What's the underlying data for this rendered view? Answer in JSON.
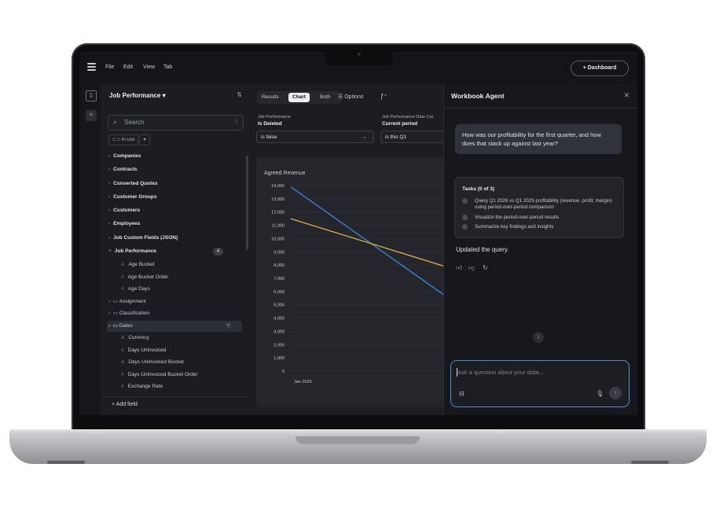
{
  "menu": {
    "file": "File",
    "edit": "Edit",
    "view": "View",
    "tab": "Tab",
    "dashboard_button": "+ Dashboard"
  },
  "panel": {
    "title": "Job Performance",
    "search_placeholder": "Search",
    "inuse_label": "In-use",
    "add_field": "+ Add field",
    "fields": [
      "Companies",
      "Contracts",
      "Converted Quotes",
      "Customer Groups",
      "Customers",
      "Employees",
      "Job Custom Fields (JSON)"
    ],
    "group": {
      "label": "Job Performance",
      "count": "4"
    },
    "subfields": [
      {
        "sym": "A",
        "label": "Age Bucket"
      },
      {
        "sym": "#",
        "label": "Age Bucket Order"
      },
      {
        "sym": "#",
        "label": "Age Days"
      }
    ],
    "folders": [
      {
        "label": "Assignment"
      },
      {
        "label": "Classification"
      },
      {
        "label": "Dates"
      }
    ],
    "subfields2": [
      {
        "sym": "A",
        "label": "Currency"
      },
      {
        "sym": "#",
        "label": "Days Uninvoiced"
      },
      {
        "sym": "A",
        "label": "Days Uninvoiced Bucket"
      },
      {
        "sym": "#",
        "label": "Days Uninvoiced Bucket Order"
      },
      {
        "sym": "#",
        "label": "Exchange Rate"
      }
    ]
  },
  "toolbar": {
    "results": "Results",
    "chart": "Chart",
    "both": "Both",
    "options": "Options"
  },
  "filters": [
    {
      "label": "Job Performance",
      "name": "Is Deleted",
      "value": "is false"
    },
    {
      "label": "Job Performance Date Cre",
      "name": "Current period",
      "value": "is this Q1"
    }
  ],
  "chart_data": {
    "type": "line",
    "title": "Agreed Revenue",
    "x": [
      "Jan 2026"
    ],
    "yticks": [
      "14,000",
      "13,000",
      "12,000",
      "11,000",
      "10,000",
      "9,000",
      "8,000",
      "7,000",
      "6,000",
      "5,000",
      "4,000",
      "3,000",
      "2,000",
      "1,000",
      "0"
    ],
    "ylim": [
      0,
      14000
    ],
    "series": [
      {
        "color": "#3c7fd6",
        "start": 13900,
        "end": 5700
      },
      {
        "color": "#e0a64a",
        "start": 11500,
        "end": 7900
      }
    ],
    "grid": true
  },
  "agent": {
    "title": "Workbook Agent",
    "user_message": "How was our profitability for the first quarter, and how does that stack up against last year?",
    "tasks_header": "Tasks (0 of 3)",
    "tasks": [
      "Query Q1 2026 vs Q1 2025 profitability (revenue, profit, margin) using period-over-period comparison",
      "Visualize the period-over-period results",
      "Summarize key findings and insights"
    ],
    "status": "Updated the query.",
    "input_placeholder": "Ask a question about your data..."
  }
}
